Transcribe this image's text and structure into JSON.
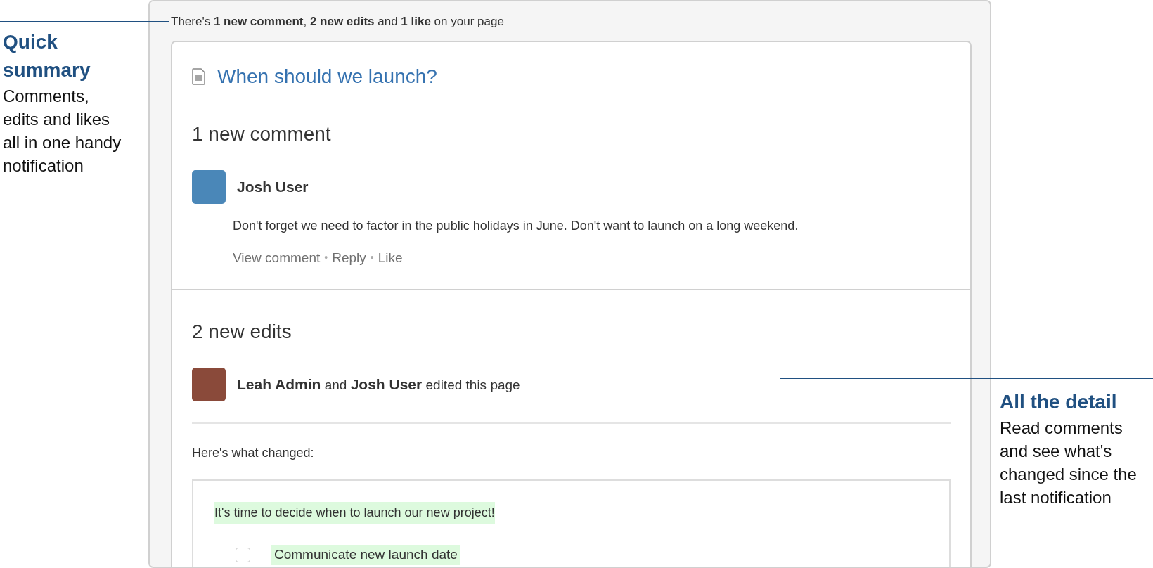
{
  "annotations": [
    {
      "title": "Quick summary",
      "text": "Comments, edits and likes all in one handy notification"
    },
    {
      "title": "All the detail",
      "text": "Read comments and see what's changed since the last notification"
    }
  ],
  "summary": "There's **1 new comment**, **2 new edits** and **1 like** on your page",
  "page_title": "When should we launch?",
  "comments_section": {
    "heading": "1 new comment",
    "author": "Josh User",
    "text": "Don't forget we need to factor in the public holidays in June. Don't want to launch on a long weekend.",
    "actions": [
      "View comment",
      "Reply",
      "Like"
    ],
    "separator": "•"
  },
  "edits_section": {
    "heading": "2 new edits",
    "editors": "**Leah Admin** and **Josh User** edited this page",
    "changed_label": "Here's what changed:",
    "changes": [
      {
        "kind": "paragraph",
        "text": "It's time to decide when to launch our new project!",
        "added": true
      },
      {
        "kind": "task",
        "text": "Communicate new launch date",
        "checked": false,
        "added": true
      }
    ]
  }
}
